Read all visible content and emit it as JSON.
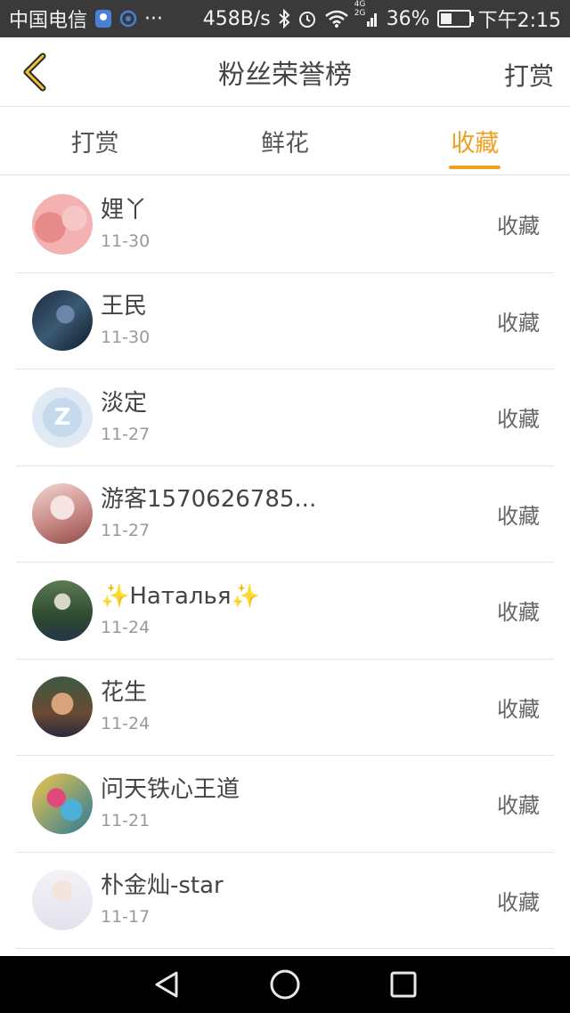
{
  "status_bar": {
    "carrier": "中国电信",
    "dots": "···",
    "speed": "458B/s",
    "network": "4G",
    "network2": "2G",
    "battery_percent": "36%",
    "battery_level": 0.36,
    "time": "下午2:15"
  },
  "header": {
    "title": "粉丝荣誉榜",
    "action_label": "打赏"
  },
  "tabs": [
    {
      "label": "打赏",
      "active": false
    },
    {
      "label": "鲜花",
      "active": false
    },
    {
      "label": "收藏",
      "active": true
    }
  ],
  "list": [
    {
      "name": "娌丫",
      "date": "11-30",
      "action": "收藏"
    },
    {
      "name": "王民",
      "date": "11-30",
      "action": "收藏"
    },
    {
      "name": "淡定",
      "date": "11-27",
      "action": "收藏"
    },
    {
      "name": "游客1570626785...",
      "date": "11-27",
      "action": "收藏"
    },
    {
      "name_prefix": "✨",
      "name": "Наталья",
      "name_suffix": "✨",
      "date": "11-24",
      "action": "收藏"
    },
    {
      "name": "花生",
      "date": "11-24",
      "action": "收藏"
    },
    {
      "name": "问天铁心王道",
      "date": "11-21",
      "action": "收藏"
    },
    {
      "name": "朴金灿-star",
      "date": "11-17",
      "action": "收藏"
    }
  ],
  "colors": {
    "accent": "#f0a020",
    "status_bar_bg": "#3a3a3a",
    "nav_bar_bg": "#000000"
  }
}
